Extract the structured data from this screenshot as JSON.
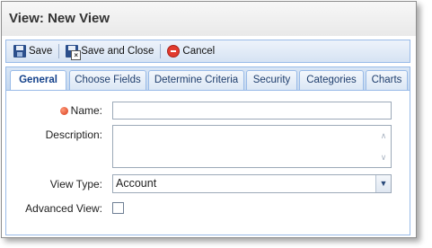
{
  "window": {
    "title": "View: New View"
  },
  "toolbar": {
    "save": {
      "label": "Save",
      "icon": "save-icon"
    },
    "save_close": {
      "label": "Save and Close",
      "icon": "save-close-icon"
    },
    "cancel": {
      "label": "Cancel",
      "icon": "cancel-icon"
    }
  },
  "tabs": [
    {
      "label": "General",
      "active": true
    },
    {
      "label": "Choose Fields",
      "active": false
    },
    {
      "label": "Determine Criteria",
      "active": false
    },
    {
      "label": "Security",
      "active": false
    },
    {
      "label": "Categories",
      "active": false
    },
    {
      "label": "Charts",
      "active": false
    }
  ],
  "form": {
    "name": {
      "label": "Name:",
      "value": "",
      "required": true
    },
    "description": {
      "label": "Description:",
      "value": ""
    },
    "view_type": {
      "label": "View Type:",
      "value": "Account"
    },
    "advanced_view": {
      "label": "Advanced View:",
      "checked": false
    }
  },
  "colors": {
    "accent_border": "#99bbe8",
    "tab_text": "#15428b",
    "required_dot": "#d63a1a",
    "cancel_icon": "#e23b2e"
  }
}
